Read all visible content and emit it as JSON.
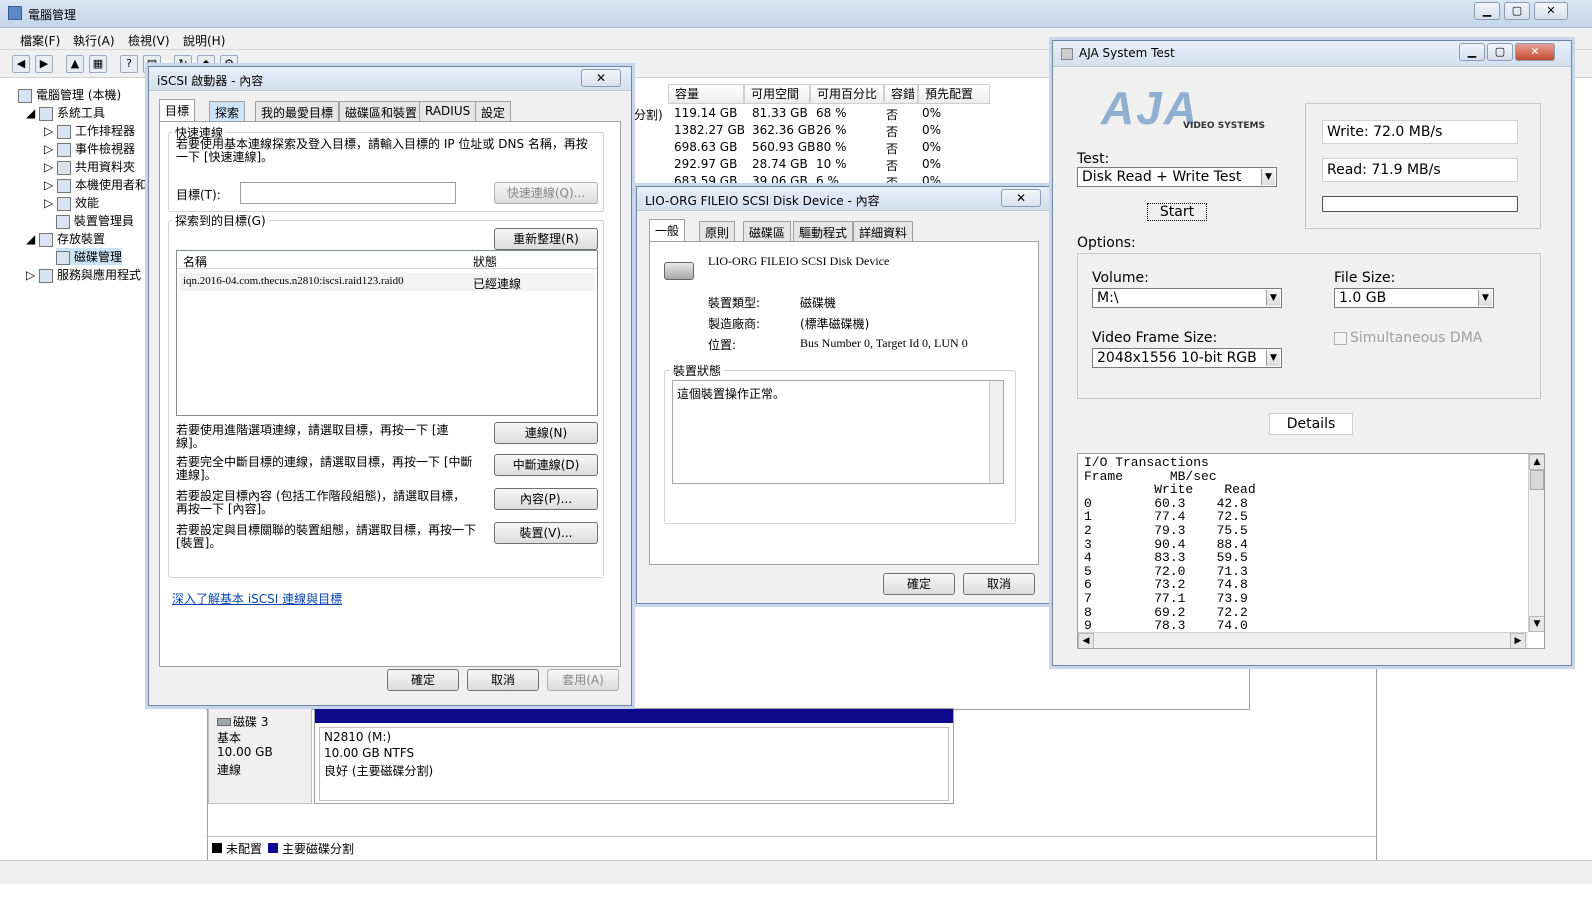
{
  "main": {
    "title": "電腦管理",
    "menu": [
      "檔案(F)",
      "執行(A)",
      "檢視(V)",
      "說明(H)"
    ],
    "tree": [
      {
        "label": "電腦管理 (本機)",
        "icon": "computer-icon"
      },
      {
        "label": "系統工具",
        "icon": "tools-icon"
      },
      {
        "label": "工作排程器",
        "icon": "clock-icon"
      },
      {
        "label": "事件檢視器",
        "icon": "event-icon"
      },
      {
        "label": "共用資料夾",
        "icon": "folder-icon"
      },
      {
        "label": "本機使用者和",
        "icon": "users-icon"
      },
      {
        "label": "效能",
        "icon": "performance-icon"
      },
      {
        "label": "裝置管理員",
        "icon": "device-icon"
      },
      {
        "label": "存放裝置",
        "icon": "storage-icon"
      },
      {
        "label": "磁碟管理",
        "icon": "disk-icon"
      },
      {
        "label": "服務與應用程式",
        "icon": "services-icon"
      }
    ],
    "columns": [
      "容量",
      "可用空間",
      "可用百分比",
      "容錯",
      "預先配置"
    ],
    "rows": [
      {
        "prefix": "分割)",
        "cap": "119.14 GB",
        "free": "81.33 GB",
        "pct": "68 %",
        "ft": "否",
        "pre": "0%"
      },
      {
        "prefix": "",
        "cap": "1382.27 GB",
        "free": "362.36 GB",
        "pct": "26 %",
        "ft": "否",
        "pre": "0%"
      },
      {
        "prefix": "",
        "cap": "698.63 GB",
        "free": "560.93 GB",
        "pct": "80 %",
        "ft": "否",
        "pre": "0%"
      },
      {
        "prefix": "",
        "cap": "292.97 GB",
        "free": "28.74 GB",
        "pct": "10 %",
        "ft": "否",
        "pre": "0%"
      },
      {
        "prefix": "",
        "cap": "683.59 GB",
        "free": "39.06 GB",
        "pct": "6 %",
        "ft": "否",
        "pre": "0%"
      }
    ],
    "disk3": {
      "name": "磁碟 3",
      "type": "基本",
      "size": "10.00 GB",
      "status": "連線",
      "volume": "N2810  (M:)",
      "volsize": "10.00 GB NTFS",
      "volstatus": "良好 (主要磁碟分割)"
    },
    "legend": {
      "unalloc": "未配置",
      "primary": "主要磁碟分割"
    }
  },
  "iscsi": {
    "title": "iSCSI 啟動器 - 內容",
    "tabs": [
      "目標",
      "探索",
      "我的最愛目標",
      "磁碟區和裝置",
      "RADIUS",
      "設定"
    ],
    "quick_label": "快速連線",
    "quick_desc": "若要使用基本連線探索及登入目標，請輸入目標的 IP 位址或 DNS 名稱，再按一下 [快速連線]。",
    "target_label": "目標(T):",
    "target_value": "",
    "quick_btn": "快速連線(Q)...",
    "discovered_label": "探索到的目標(G)",
    "refresh_btn": "重新整理(R)",
    "col_name": "名稱",
    "col_status": "狀態",
    "target_name": "iqn.2016-04.com.thecus.n2810:iscsi.raid123.raid0",
    "target_status": "已經連線",
    "hint_connect": "若要使用進階選項連線，請選取目標，再按一下 [連線]。",
    "btn_connect": "連線(N)",
    "hint_disconnect": "若要完全中斷目標的連線，請選取目標，再按一下 [中斷連線]。",
    "btn_disconnect": "中斷連線(D)",
    "hint_props": "若要設定目標內容 (包括工作階段組態)，請選取目標，再按一下 [內容]。",
    "btn_props": "內容(P)...",
    "hint_devices": "若要設定與目標關聯的裝置組態，請選取目標，再按一下 [裝置]。",
    "btn_devices": "裝置(V)...",
    "link": "深入了解基本 iSCSI 連線與目標",
    "ok": "確定",
    "cancel": "取消",
    "apply": "套用(A)"
  },
  "device": {
    "title": "LIO-ORG FILEIO SCSI Disk Device - 內容",
    "tabs": [
      "一般",
      "原則",
      "磁碟區",
      "驅動程式",
      "詳細資料"
    ],
    "name": "LIO-ORG FILEIO SCSI Disk Device",
    "type_label": "裝置類型:",
    "type_value": "磁碟機",
    "mfr_label": "製造廠商:",
    "mfr_value": "(標準磁碟機)",
    "loc_label": "位置:",
    "loc_value": "Bus Number 0, Target Id 0, LUN 0",
    "status_label": "裝置狀態",
    "status_text": "這個裝置操作正常。",
    "ok": "確定",
    "cancel": "取消"
  },
  "aja": {
    "title": "AJA System Test",
    "logo_text": "AJA",
    "logo_sub": "VIDEO SYSTEMS",
    "test_label": "Test:",
    "test_value": "Disk Read + Write Test",
    "start": "Start",
    "write": "Write: 72.0 MB/s",
    "read": "Read: 71.9 MB/s",
    "options_label": "Options:",
    "volume_label": "Volume:",
    "volume_value": "M:\\",
    "filesize_label": "File Size:",
    "filesize_value": "1.0 GB",
    "framesize_label": "Video Frame Size:",
    "framesize_value": "2048x1556 10-bit RGB",
    "dma_label": "Simultaneous DMA",
    "details": "Details",
    "log_header1": "I/O Transactions",
    "log_header2": "Frame      MB/sec",
    "log_header3": "         Write    Read",
    "log_rows": [
      "0        60.3    42.8",
      "1        77.4    72.5",
      "2        79.3    75.5",
      "3        90.4    88.4",
      "4        83.3    59.5",
      "5        72.0    71.3",
      "6        73.2    74.8",
      "7        77.1    73.9",
      "8        69.2    72.2",
      "9        78.3    74.0"
    ]
  }
}
